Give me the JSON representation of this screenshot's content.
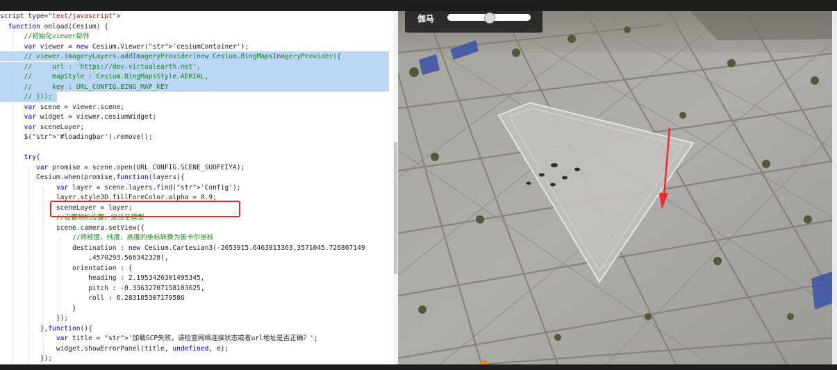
{
  "code_editor": {
    "lines": [
      "script type=\"text/javascript\">",
      "  function onload(Cesium) {",
      "      //初始化viewer部件",
      "      var viewer = new Cesium.Viewer('cesiumContainer');",
      "      // viewer.imageryLayers.addImageryProvider(new Cesium.BingMapsImageryProvider({",
      "      //     url : 'https://dev.virtualearth.net',",
      "      //     mapStyle : Cesium.BingMapsStyle.AERIAL,",
      "      //     key : URL_CONFIG.BING_MAP_KEY",
      "      // }));",
      "      var scene = viewer.scene;",
      "      var widget = viewer.cesiumWidget;",
      "      var sceneLayer;",
      "      $('#loadingbar').remove();",
      "",
      "      try{",
      "         var promise = scene.open(URL_CONFIG.SCENE_SUOFEIYA);",
      "         Cesium.when(promise,function(layers){",
      "              var layer = scene.layers.find('Config');",
      "              layer.style3D.fillForeColor.alpha = 0.9;",
      "              sceneLayer = layer;",
      "              //设置相机位置，定位至模型",
      "              scene.camera.setView({",
      "                  //将经度、纬度、高度的坐标转换为笛卡尔坐标",
      "                  destination : new Cesium.Cartesian3(-2653915.6463913363,3571045.726807149",
      "                      ,4570293.566342328),",
      "                  orientation : {",
      "                      heading : 2.1953426301495345,",
      "                      pitch : -0.33632707158103625,",
      "                      roll : 6.283185307179586",
      "                  }",
      "              });",
      "          },function(){",
      "              var title = '加载SCP失败，请检查网络连接状态或者url地址是否正确？';",
      "              widget.showErrorPanel(title, undefined, e);",
      "          });"
    ]
  },
  "viewer_panel": {
    "label": "伽马"
  },
  "gamma_slider": {
    "value": 0.5
  },
  "colors": {
    "selection": "#bcd6f5",
    "highlight_box": "#e02a2a",
    "arrow": "#f02a2a"
  }
}
